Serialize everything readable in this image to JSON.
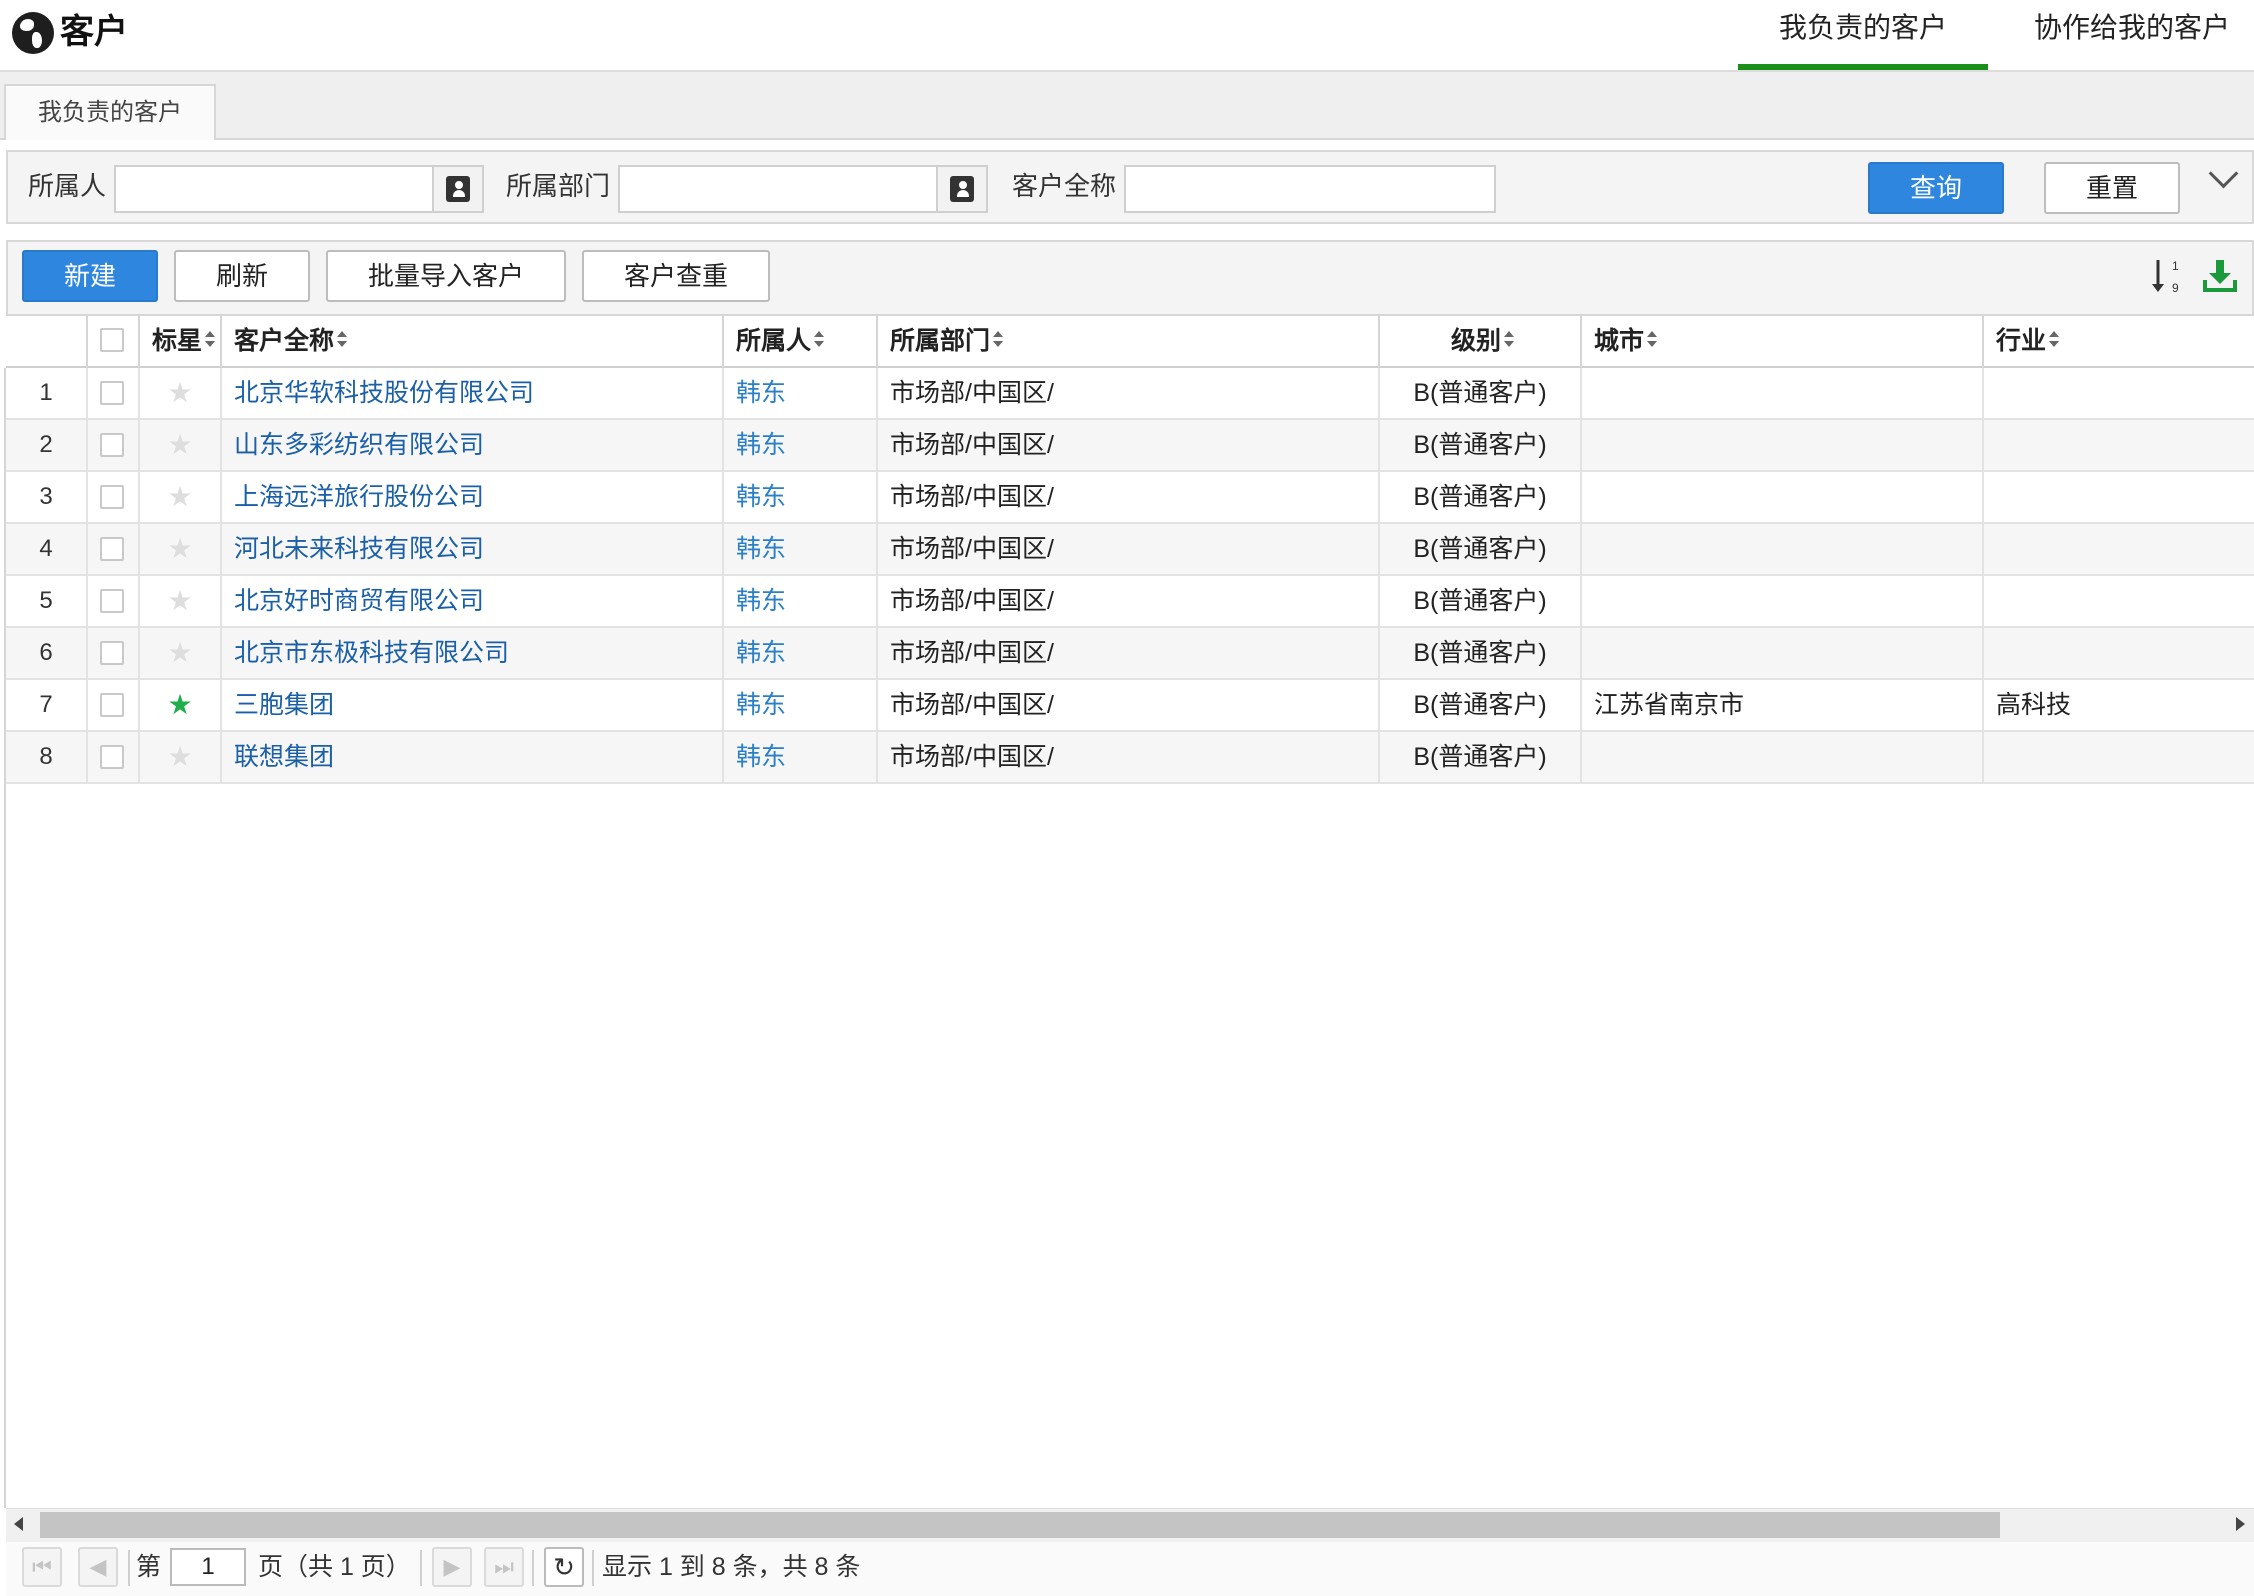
{
  "header": {
    "app_icon": "globe-icon",
    "title": "客户",
    "tabs": [
      {
        "label": "我负责的客户",
        "active": true
      },
      {
        "label": "协作给我的客户",
        "active": false
      }
    ],
    "accent_color": "#1a8f1a"
  },
  "subtab": {
    "label": "我负责的客户"
  },
  "filters": {
    "owner_label": "所属人",
    "owner_value": "",
    "dept_label": "所属部门",
    "dept_value": "",
    "name_label": "客户全称",
    "name_value": "",
    "picker_icon": "contact-book-icon",
    "query_button": "查询",
    "reset_button": "重置",
    "expand_icon": "chevron-down-icon"
  },
  "toolbar": {
    "new_button": "新建",
    "refresh_button": "刷新",
    "import_button": "批量导入客户",
    "dedupe_button": "客户查重",
    "sort_icon": "sort-numeric-icon",
    "export_icon": "download-icon",
    "primary_color": "#2e86de"
  },
  "table": {
    "columns": [
      "标星",
      "客户全称",
      "所属人",
      "所属部门",
      "级别",
      "城市",
      "行业"
    ],
    "rows": [
      {
        "no": "1",
        "starred": false,
        "name": "北京华软科技股份有限公司",
        "owner": "韩东",
        "dept": "市场部/中国区/",
        "level": "B(普通客户)",
        "city": "",
        "industry": ""
      },
      {
        "no": "2",
        "starred": false,
        "name": "山东多彩纺织有限公司",
        "owner": "韩东",
        "dept": "市场部/中国区/",
        "level": "B(普通客户)",
        "city": "",
        "industry": ""
      },
      {
        "no": "3",
        "starred": false,
        "name": "上海远洋旅行股份公司",
        "owner": "韩东",
        "dept": "市场部/中国区/",
        "level": "B(普通客户)",
        "city": "",
        "industry": ""
      },
      {
        "no": "4",
        "starred": false,
        "name": "河北未来科技有限公司",
        "owner": "韩东",
        "dept": "市场部/中国区/",
        "level": "B(普通客户)",
        "city": "",
        "industry": ""
      },
      {
        "no": "5",
        "starred": false,
        "name": "北京好时商贸有限公司",
        "owner": "韩东",
        "dept": "市场部/中国区/",
        "level": "B(普通客户)",
        "city": "",
        "industry": ""
      },
      {
        "no": "6",
        "starred": false,
        "name": "北京市东极科技有限公司",
        "owner": "韩东",
        "dept": "市场部/中国区/",
        "level": "B(普通客户)",
        "city": "",
        "industry": ""
      },
      {
        "no": "7",
        "starred": true,
        "name": "三胞集团",
        "owner": "韩东",
        "dept": "市场部/中国区/",
        "level": "B(普通客户)",
        "city": "江苏省南京市",
        "industry": "高科技"
      },
      {
        "no": "8",
        "starred": false,
        "name": "联想集团",
        "owner": "韩东",
        "dept": "市场部/中国区/",
        "level": "B(普通客户)",
        "city": "",
        "industry": ""
      }
    ],
    "star_on_color": "#1fae4b",
    "star_off_color": "#dedede"
  },
  "pager": {
    "page_prefix": "第",
    "page_value": "1",
    "page_suffix": "页（共 1 页）",
    "summary": "显示 1 到 8 条，共 8 条",
    "first_icon": "first-page-icon",
    "prev_icon": "prev-page-icon",
    "next_icon": "next-page-icon",
    "last_icon": "last-page-icon",
    "reload_icon": "refresh-icon"
  }
}
